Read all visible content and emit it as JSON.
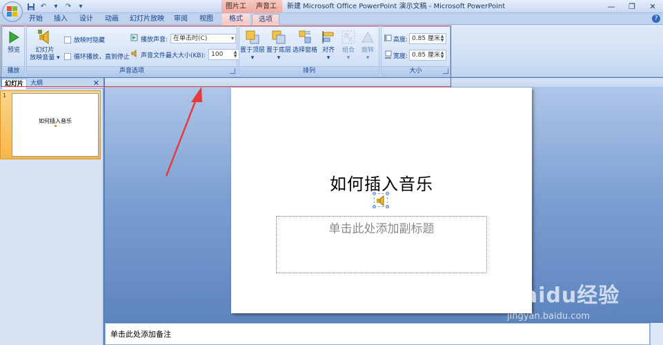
{
  "window": {
    "title": "新建 Microsoft Office PowerPoint 演示文稿 - Microsoft PowerPoint",
    "context_picture_tools": "图片工具",
    "context_sound_tools": "声音工具"
  },
  "tabs": [
    {
      "label": "开始"
    },
    {
      "label": "插入"
    },
    {
      "label": "设计"
    },
    {
      "label": "动画"
    },
    {
      "label": "幻灯片放映"
    },
    {
      "label": "审阅"
    },
    {
      "label": "视图"
    },
    {
      "label": "格式"
    },
    {
      "label": "选项"
    }
  ],
  "ribbon": {
    "play_group": {
      "label": "播放",
      "preview": "预览"
    },
    "sound_options_group": {
      "label": "声音选项",
      "slideshow_volume_line1": "幻灯片",
      "slideshow_volume_line2": "放映音量 ▾",
      "hide_during_show": "放映时隐藏",
      "loop_until_stopped": "循环播放，直到停止",
      "play_sound_label": "播放声音:",
      "play_sound_value": "在单击时(C)",
      "max_file_size_label": "声音文件最大大小(KB):",
      "max_file_size_value": "100"
    },
    "arrange_group": {
      "label": "排列",
      "bring_to_front": "置于顶层",
      "send_to_back": "置于底层",
      "selection_pane": "选择窗格",
      "align": "对齐",
      "group": "组合",
      "rotate": "旋转"
    },
    "size_group": {
      "label": "大小",
      "height_label": "高度:",
      "height_value": "0.85 厘米",
      "width_label": "宽度:",
      "width_value": "0.85 厘米"
    }
  },
  "left_panel": {
    "tab_slides": "幻灯片",
    "tab_outline": "大纲",
    "close": "✕",
    "slide_number": "1",
    "thumb_title": "如何插入音乐"
  },
  "slide": {
    "title": "如何插入音乐",
    "subtitle_placeholder": "单击此处添加副标题"
  },
  "notes": {
    "placeholder": "单击此处添加备注"
  },
  "watermark": {
    "logo": "Baidu经验",
    "url": "jingyan.baidu.com"
  }
}
